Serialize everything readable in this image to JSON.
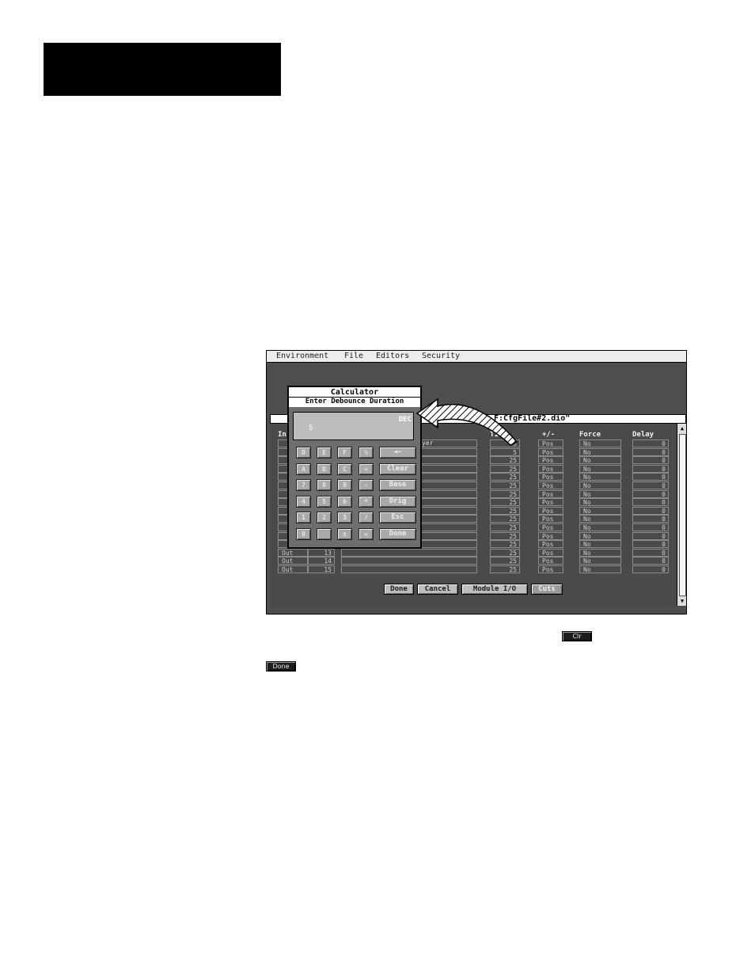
{
  "menu": [
    "Environment",
    "File",
    "Editors",
    "Security"
  ],
  "window_title": "F:CfgFile#2.dio\"",
  "headers": {
    "in": "In",
    "cyer": "yer",
    "time": "Time",
    "pm": "+/-",
    "force": "Force",
    "delay": "Delay"
  },
  "rows": [
    {
      "label": "",
      "num": "",
      "time": "5",
      "pm": "Pos",
      "force": "No",
      "delay": "0"
    },
    {
      "label": "",
      "num": "",
      "time": "5",
      "pm": "Pos",
      "force": "No",
      "delay": "0"
    },
    {
      "label": "",
      "num": "",
      "time": "25",
      "pm": "Pos",
      "force": "No",
      "delay": "0"
    },
    {
      "label": "",
      "num": "",
      "time": "25",
      "pm": "Pos",
      "force": "No",
      "delay": "0"
    },
    {
      "label": "",
      "num": "",
      "time": "25",
      "pm": "Pos",
      "force": "No",
      "delay": "0"
    },
    {
      "label": "",
      "num": "",
      "time": "25",
      "pm": "Pos",
      "force": "No",
      "delay": "0"
    },
    {
      "label": "",
      "num": "",
      "time": "25",
      "pm": "Pos",
      "force": "No",
      "delay": "0"
    },
    {
      "label": "",
      "num": "",
      "time": "25",
      "pm": "Pos",
      "force": "No",
      "delay": "0"
    },
    {
      "label": "",
      "num": "",
      "time": "25",
      "pm": "Pos",
      "force": "No",
      "delay": "0"
    },
    {
      "label": "",
      "num": "",
      "time": "25",
      "pm": "Pos",
      "force": "No",
      "delay": "0"
    },
    {
      "label": "",
      "num": "",
      "time": "25",
      "pm": "Pos",
      "force": "No",
      "delay": "0"
    },
    {
      "label": "",
      "num": "",
      "time": "25",
      "pm": "Pos",
      "force": "No",
      "delay": "0"
    },
    {
      "label": "",
      "num": "",
      "time": "25",
      "pm": "Pos",
      "force": "No",
      "delay": "0"
    },
    {
      "label": "Out",
      "num": "13",
      "time": "25",
      "pm": "Pos",
      "force": "No",
      "delay": "0"
    },
    {
      "label": "Out",
      "num": "14",
      "time": "25",
      "pm": "Pos",
      "force": "No",
      "delay": "0"
    },
    {
      "label": "Out",
      "num": "15",
      "time": "25",
      "pm": "Pos",
      "force": "No",
      "delay": "0"
    }
  ],
  "screen_buttons": {
    "done": "Done",
    "cancel": "Cancel",
    "module_io": "Module I/O",
    "cuts": "Cuts"
  },
  "calculator": {
    "title": "Calculator",
    "prompt": "Enter Debounce Duration",
    "mode": "DEC",
    "value": "5",
    "keys": [
      [
        "D",
        "E",
        "F",
        "%"
      ],
      [
        "A",
        "B",
        "C",
        "+"
      ],
      [
        "7",
        "8",
        "9",
        "-"
      ],
      [
        "4",
        "5",
        "6",
        "*"
      ],
      [
        "1",
        "2",
        "3",
        "/"
      ],
      [
        "0",
        "",
        "±",
        "="
      ]
    ],
    "wide_keys": [
      "◄-",
      "Clear",
      "Base",
      "Orig",
      "Esc",
      "Done"
    ]
  },
  "page_buttons": {
    "clr": "Clr",
    "done": "Done"
  }
}
